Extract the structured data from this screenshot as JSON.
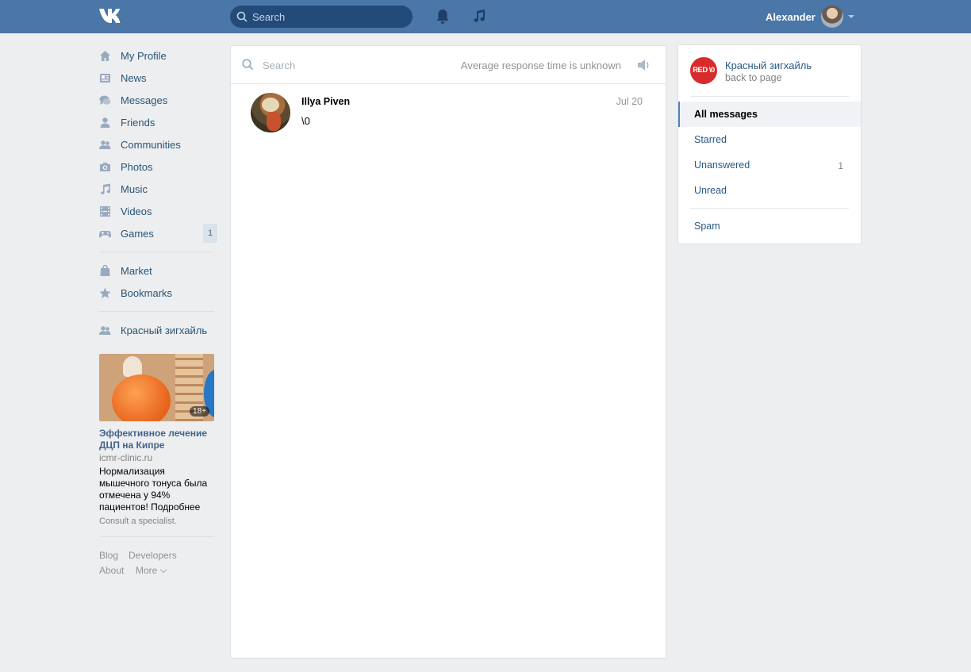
{
  "header": {
    "search_placeholder": "Search",
    "user_name": "Alexander",
    "icons": [
      "vk-logo-icon",
      "search-icon",
      "bell-icon",
      "music-icon",
      "caret-down-icon"
    ]
  },
  "sidebar": {
    "items": [
      {
        "label": "My Profile",
        "icon": "home-icon"
      },
      {
        "label": "News",
        "icon": "news-icon"
      },
      {
        "label": "Messages",
        "icon": "messages-icon"
      },
      {
        "label": "Friends",
        "icon": "friend-icon"
      },
      {
        "label": "Communities",
        "icon": "communities-icon"
      },
      {
        "label": "Photos",
        "icon": "camera-icon"
      },
      {
        "label": "Music",
        "icon": "music-icon"
      },
      {
        "label": "Videos",
        "icon": "film-icon"
      },
      {
        "label": "Games",
        "icon": "gamepad-icon",
        "count": "1"
      }
    ],
    "items2": [
      {
        "label": "Market",
        "icon": "bag-icon"
      },
      {
        "label": "Bookmarks",
        "icon": "star-icon"
      }
    ],
    "items3": [
      {
        "label": "Красный зигхайль",
        "icon": "communities-icon"
      }
    ]
  },
  "ad": {
    "badge": "18+",
    "title": "Эффективное лечение ДЦП на Кипре",
    "domain": "icmr-clinic.ru",
    "text": "Нормализация мышечного тонуса была отмечена у 94% пациентов! Подробнее",
    "disclaimer": "Consult a specialist."
  },
  "footer": {
    "blog": "Blog",
    "developers": "Developers",
    "about": "About",
    "more": "More"
  },
  "main": {
    "search_placeholder": "Search",
    "response_time": "Average response time is unknown",
    "dialogs": [
      {
        "name": "Illya Piven",
        "date": "Jul 20",
        "message": "\\0"
      }
    ]
  },
  "right": {
    "group_name": "Красный зигхайль",
    "group_logo_text": "RED \\0",
    "back_label": "back to page",
    "filters": [
      {
        "label": "All messages",
        "active": true
      },
      {
        "label": "Starred"
      },
      {
        "label": "Unanswered",
        "count": "1"
      },
      {
        "label": "Unread"
      }
    ],
    "spam_label": "Spam"
  },
  "colors": {
    "header_bg": "#4a76a8",
    "page_bg": "#edeef0",
    "link": "#2a5885",
    "accent": "#5181b8"
  }
}
